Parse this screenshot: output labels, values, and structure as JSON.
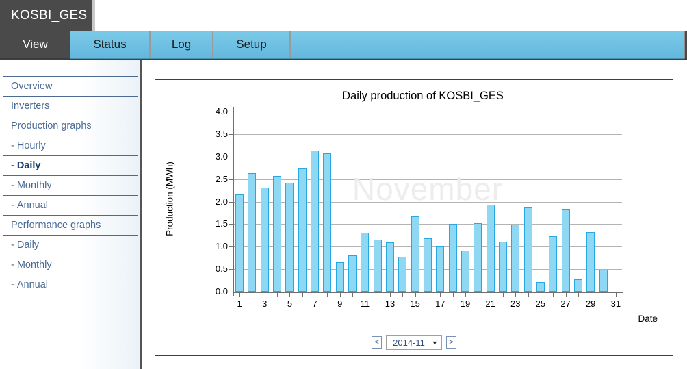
{
  "app": {
    "title": "KOSBI_GES"
  },
  "tabs": [
    {
      "label": "View",
      "active": true
    },
    {
      "label": "Status",
      "active": false
    },
    {
      "label": "Log",
      "active": false
    },
    {
      "label": "Setup",
      "active": false
    }
  ],
  "sidebar": {
    "items": [
      {
        "label": "Overview",
        "sub": false,
        "selected": false
      },
      {
        "label": "Inverters",
        "sub": false,
        "selected": false
      },
      {
        "label": "Production graphs",
        "sub": false,
        "selected": false
      },
      {
        "label": "Hourly",
        "sub": true,
        "selected": false
      },
      {
        "label": "Daily",
        "sub": true,
        "selected": true
      },
      {
        "label": "Monthly",
        "sub": true,
        "selected": false
      },
      {
        "label": "Annual",
        "sub": true,
        "selected": false
      },
      {
        "label": "Performance graphs",
        "sub": false,
        "selected": false
      },
      {
        "label": "Daily",
        "sub": true,
        "selected": false
      },
      {
        "label": "Monthly",
        "sub": true,
        "selected": false
      },
      {
        "label": "Annual",
        "sub": true,
        "selected": false
      }
    ]
  },
  "date_nav": {
    "prev_label": "<",
    "next_label": ">",
    "selected_month": "2014-11",
    "caret": "▼"
  },
  "colors": {
    "bar_fill": "#8fd8f4",
    "bar_border": "#27a8e0",
    "tab_blue": "#6fc0e3",
    "header_dark": "#4a4a4a",
    "nav_text": "#4a6b96",
    "watermark": "#ededed"
  },
  "chart_data": {
    "type": "bar",
    "title": "Daily production of KOSBI_GES",
    "xlabel": "Date",
    "ylabel": "Production (MWh)",
    "watermark": "November",
    "grid": true,
    "legend": "none",
    "ylim": [
      0.0,
      4.0
    ],
    "yticks": [
      0.0,
      0.5,
      1.0,
      1.5,
      2.0,
      2.5,
      3.0,
      3.5,
      4.0
    ],
    "ytick_labels": [
      "0.0",
      "0.5",
      "1.0",
      "1.5",
      "2.0",
      "2.5",
      "3.0",
      "3.5",
      "4.0"
    ],
    "xlim": [
      1,
      31
    ],
    "xticks": [
      1,
      2,
      3,
      4,
      5,
      6,
      7,
      8,
      9,
      10,
      11,
      12,
      13,
      14,
      15,
      16,
      17,
      18,
      19,
      20,
      21,
      22,
      23,
      24,
      25,
      26,
      27,
      28,
      29,
      30,
      31
    ],
    "xtick_labels": [
      "1",
      "",
      "3",
      "",
      "5",
      "",
      "7",
      "",
      "9",
      "",
      "11",
      "",
      "13",
      "",
      "15",
      "",
      "17",
      "",
      "19",
      "",
      "21",
      "",
      "23",
      "",
      "25",
      "",
      "27",
      "",
      "29",
      "",
      "31"
    ],
    "categories": [
      1,
      2,
      3,
      4,
      5,
      6,
      7,
      8,
      9,
      10,
      11,
      12,
      13,
      14,
      15,
      16,
      17,
      18,
      19,
      20,
      21,
      22,
      23,
      24,
      25,
      26,
      27,
      28,
      29,
      30,
      31
    ],
    "values": [
      2.16,
      2.63,
      2.31,
      2.57,
      2.42,
      2.74,
      3.13,
      3.08,
      0.65,
      0.81,
      1.31,
      1.16,
      1.1,
      0.78,
      1.68,
      1.19,
      1.0,
      1.51,
      0.92,
      1.52,
      1.93,
      1.11,
      1.49,
      1.87,
      0.21,
      1.23,
      1.83,
      0.28,
      1.32,
      0.49,
      0.0
    ]
  }
}
